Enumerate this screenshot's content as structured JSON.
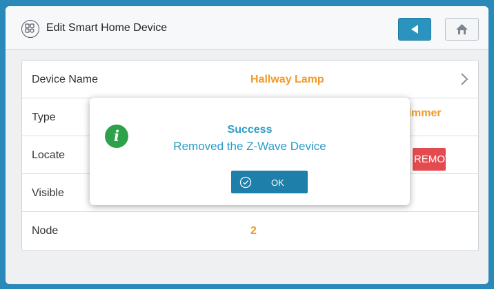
{
  "header": {
    "title": "Edit Smart Home Device",
    "device_icon": "smart-device-grid-icon",
    "back_icon": "back-arrow-icon",
    "home_icon": "home-icon"
  },
  "rows": [
    {
      "label": "Device Name",
      "value": "Hallway Lamp"
    },
    {
      "label": "Type",
      "value": "Dimmer"
    },
    {
      "label": "Locate",
      "action": "REMOVE"
    },
    {
      "label": "Visible",
      "value": ""
    },
    {
      "label": "Node",
      "value": "2"
    }
  ],
  "modal": {
    "title": "Success",
    "message": "Removed the Z-Wave Device",
    "ok_label": "OK",
    "info_icon": "info-icon",
    "ok_icon": "check-circle-icon"
  },
  "colors": {
    "background": "#2a89b8",
    "accent": "#2a9bc8",
    "value_orange": "#f29a28",
    "remove_red": "#e44b50",
    "success_green": "#2ea24a"
  }
}
